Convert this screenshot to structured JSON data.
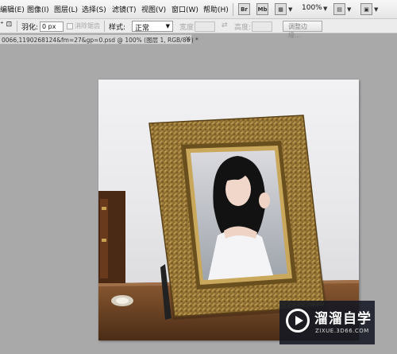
{
  "menubar": {
    "items": [
      "编辑(E)",
      "图像(I)",
      "图层(L)",
      "选择(S)",
      "滤镜(T)",
      "视图(V)",
      "窗口(W)",
      "帮助(H)"
    ],
    "zoom": "100%",
    "bridge_label": "Br",
    "minibridge_label": "Mb"
  },
  "optionsbar": {
    "feather_label": "羽化:",
    "feather_value": "0 px",
    "antialias_label": "消除锯齿",
    "style_label": "样式:",
    "style_value": "正常",
    "width_label": "宽度:",
    "height_label": "高度:",
    "refine_edge": "调整边缘..."
  },
  "document": {
    "tab_title": "0066,1190268124&fm=27&gp=0.psd @ 100% (图层 1, RGB/8#) *",
    "close": "×"
  },
  "watermark": {
    "name": "溜溜自学",
    "url": "ZIXUE.3D66.COM"
  },
  "colors": {
    "frame_gold": "#9a7a35",
    "canvas_bg": "#a9a9a9",
    "watermark_bg": "#141823"
  }
}
